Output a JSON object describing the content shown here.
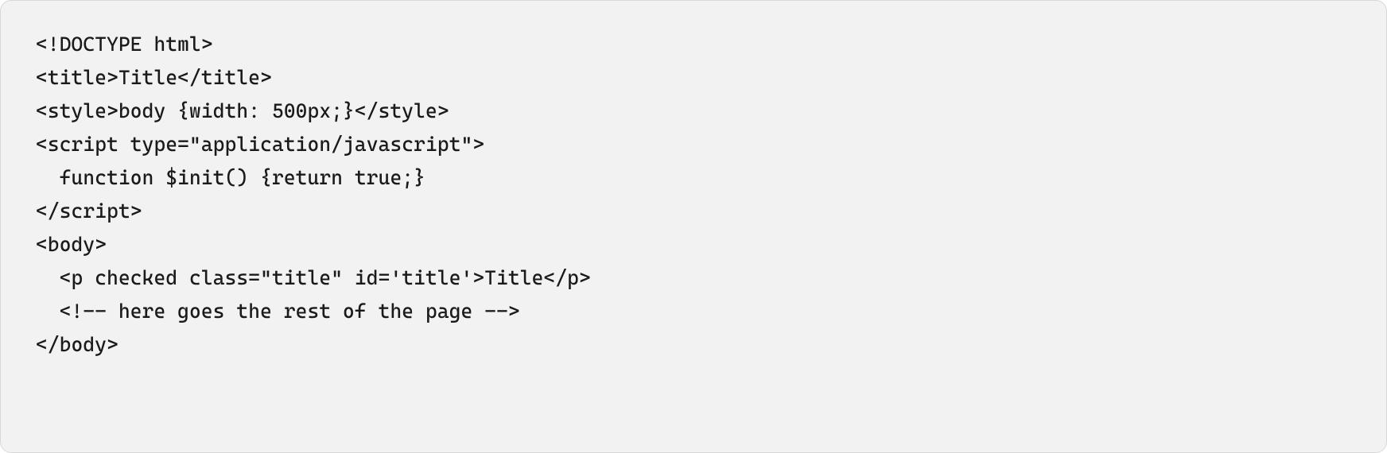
{
  "code": {
    "lines": [
      "<!DOCTYPE html>",
      "<title>Title</title>",
      "<style>body {width: 500px;}</style>",
      "<script type=\"application/javascript\">",
      "  function $init() {return true;}",
      "</script>",
      "<body>",
      "  <p checked class=\"title\" id='title'>Title</p>",
      "  <!-- here goes the rest of the page -->",
      "</body>"
    ]
  }
}
